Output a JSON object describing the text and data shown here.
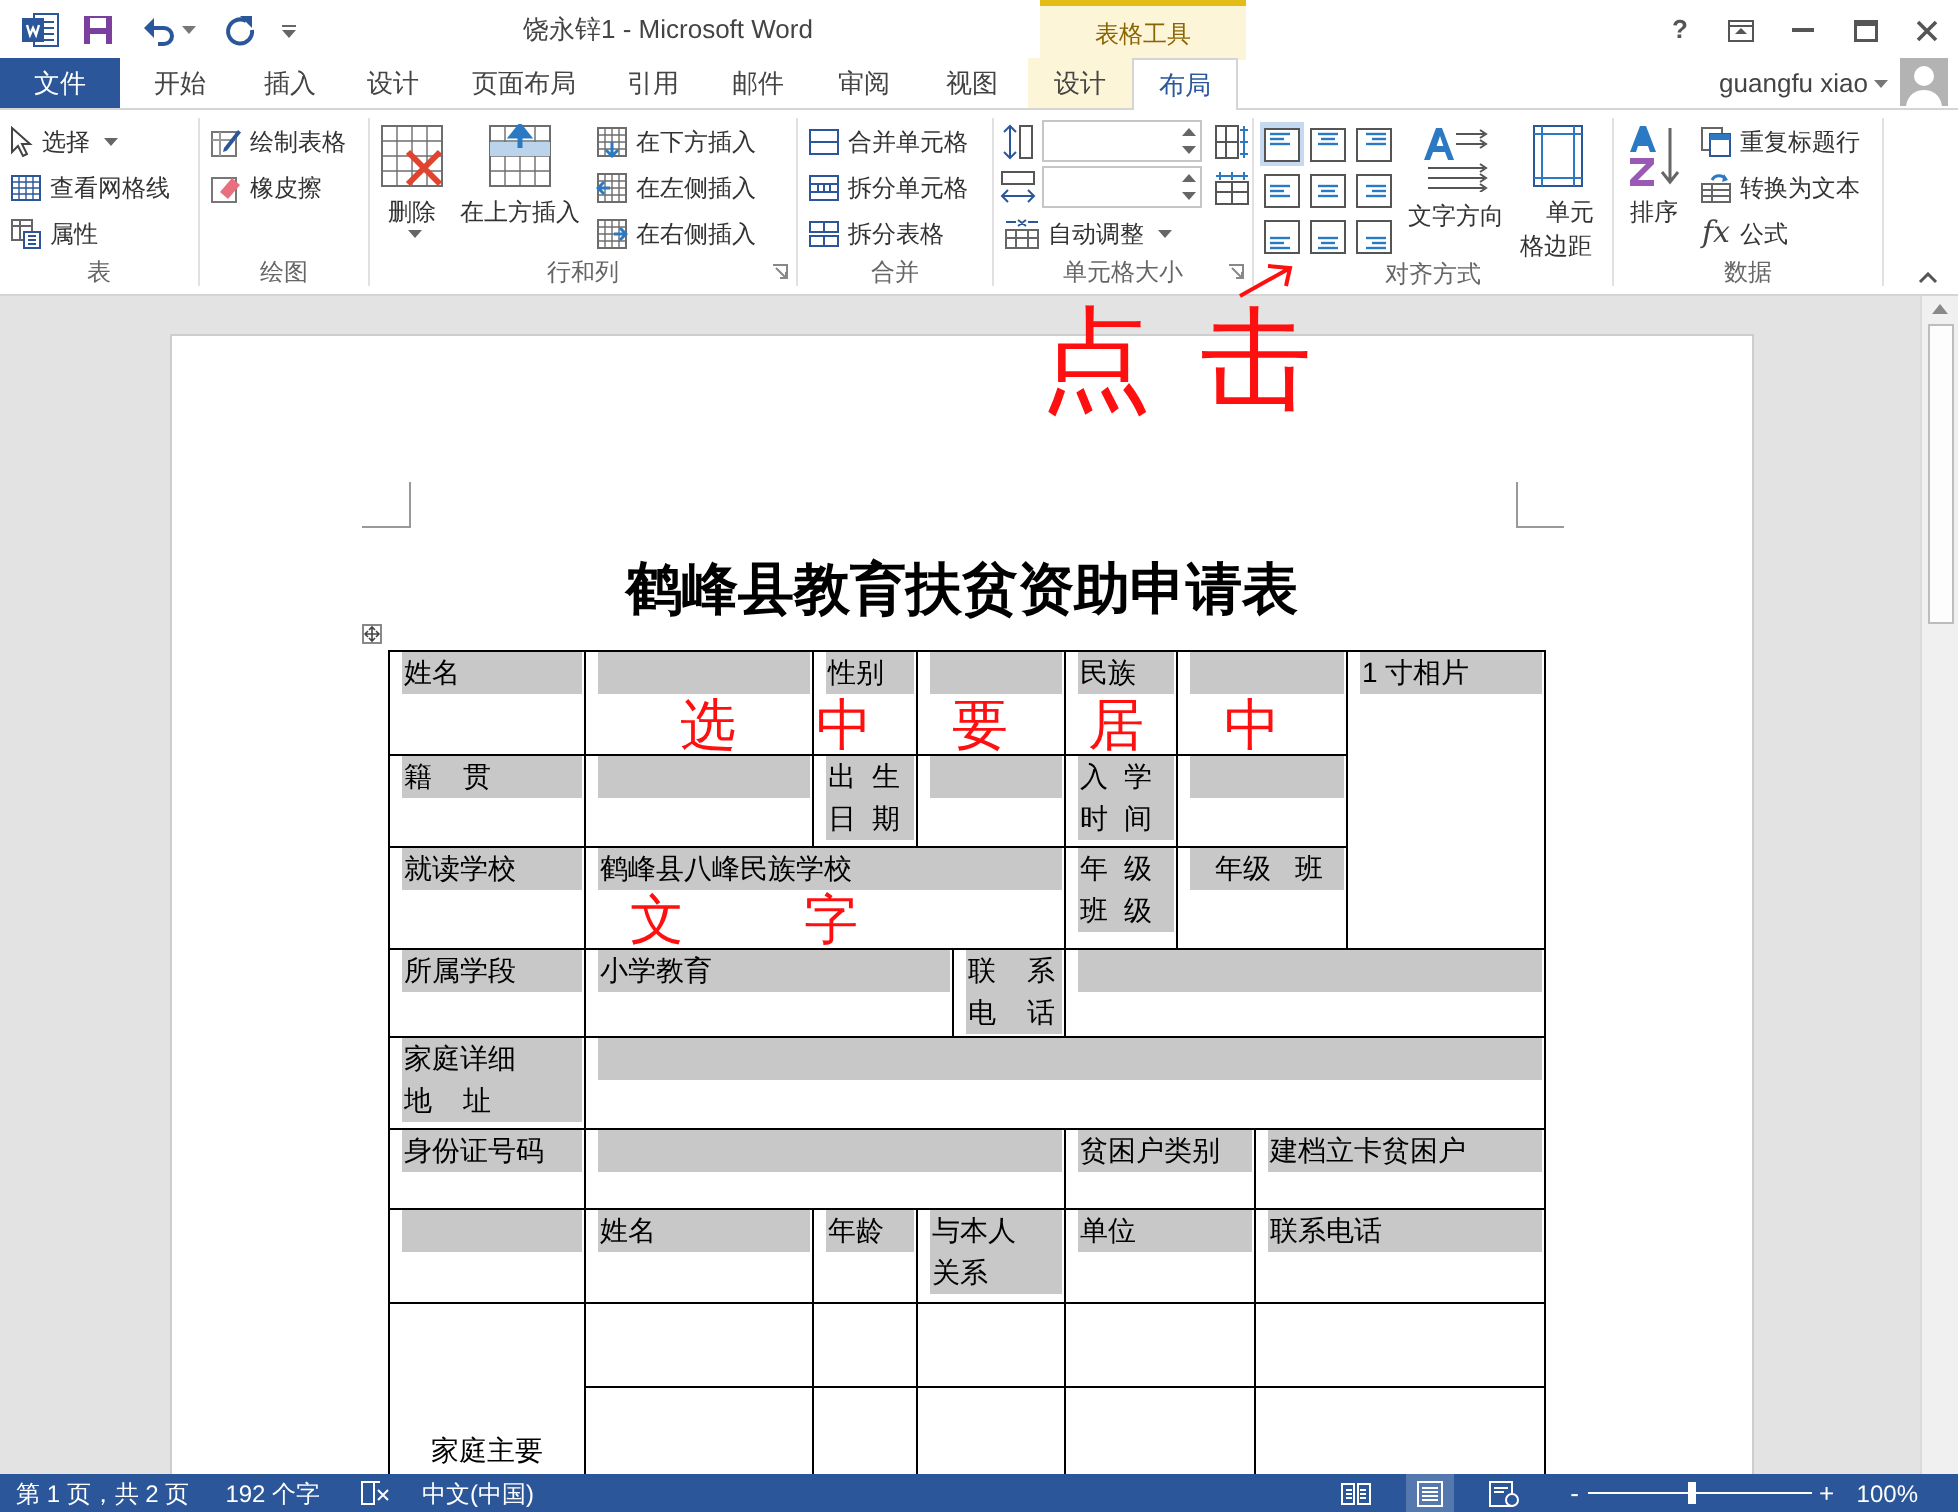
{
  "title_bar": {
    "title": "饶永锌1 - Microsoft Word",
    "contextual_group": "表格工具",
    "help": "?"
  },
  "tabs": [
    {
      "label": "文件",
      "kind": "file",
      "selected": false
    },
    {
      "label": "开始",
      "kind": "normal",
      "selected": false
    },
    {
      "label": "插入",
      "kind": "normal",
      "selected": false
    },
    {
      "label": "设计",
      "kind": "normal",
      "selected": false
    },
    {
      "label": "页面布局",
      "kind": "normal",
      "selected": false
    },
    {
      "label": "引用",
      "kind": "normal",
      "selected": false
    },
    {
      "label": "邮件",
      "kind": "normal",
      "selected": false
    },
    {
      "label": "审阅",
      "kind": "normal",
      "selected": false
    },
    {
      "label": "视图",
      "kind": "normal",
      "selected": false
    },
    {
      "label": "设计",
      "kind": "contextual",
      "selected": false
    },
    {
      "label": "布局",
      "kind": "contextual",
      "selected": true
    }
  ],
  "user": {
    "name": "guangfu xiao"
  },
  "ribbon": {
    "groups": [
      {
        "label": "表",
        "items": [
          {
            "kind": "small",
            "label": "选择",
            "dropdown": true
          },
          {
            "kind": "small",
            "label": "查看网格线"
          },
          {
            "kind": "small",
            "label": "属性"
          }
        ]
      },
      {
        "label": "绘图",
        "items": [
          {
            "kind": "small",
            "label": "绘制表格"
          },
          {
            "kind": "small",
            "label": "橡皮擦"
          }
        ]
      },
      {
        "label": "行和列",
        "launcher": true,
        "items": [
          {
            "kind": "large",
            "label": "删除",
            "dropdown": true
          },
          {
            "kind": "large",
            "label": "在上方插入"
          },
          {
            "kind": "small",
            "label": "在下方插入"
          },
          {
            "kind": "small",
            "label": "在左侧插入"
          },
          {
            "kind": "small",
            "label": "在右侧插入"
          }
        ]
      },
      {
        "label": "合并",
        "items": [
          {
            "kind": "small",
            "label": "合并单元格"
          },
          {
            "kind": "small",
            "label": "拆分单元格"
          },
          {
            "kind": "small",
            "label": "拆分表格"
          }
        ]
      },
      {
        "label": "单元格大小",
        "launcher": true,
        "items": [
          {
            "kind": "spinner"
          },
          {
            "kind": "spinner"
          },
          {
            "kind": "small",
            "label": "自动调整",
            "dropdown": true
          },
          {
            "kind": "icon"
          },
          {
            "kind": "icon"
          }
        ]
      },
      {
        "label": "对齐方式",
        "items": [
          {
            "kind": "align_grid",
            "cells": [
              {
                "selected": true
              },
              {
                "selected": false
              },
              {
                "selected": false
              },
              {
                "selected": false
              },
              {
                "selected": false
              },
              {
                "selected": false
              },
              {
                "selected": false
              },
              {
                "selected": false
              },
              {
                "selected": false
              }
            ]
          },
          {
            "kind": "large",
            "label": "文字方向"
          },
          {
            "kind": "large",
            "label": "单元格边距"
          }
        ]
      },
      {
        "label": "数据",
        "items": [
          {
            "kind": "large",
            "label": "排序"
          },
          {
            "kind": "small",
            "label": "重复标题行"
          },
          {
            "kind": "small",
            "label": "转换为文本"
          },
          {
            "kind": "small",
            "label": "公式",
            "glyph": "fx"
          }
        ]
      }
    ]
  },
  "document": {
    "heading": "鹤峰县教育扶贫资助申请表",
    "table": {
      "rows": [
        [
          {
            "text": "姓名",
            "selected": true
          },
          {
            "selected": true
          },
          {
            "text": "性别",
            "selected": true
          },
          {
            "selected": true
          },
          {
            "text": "民族",
            "selected": true
          },
          {
            "selected": true
          },
          {
            "text": "1 寸相片",
            "selected": true
          }
        ],
        [
          {
            "text": "籍    贯",
            "selected": true
          },
          {
            "selected": true
          },
          {
            "text": "出  生日  期",
            "selected": true
          },
          {
            "selected": true
          },
          {
            "text": "入  学时  间",
            "selected": true
          },
          {
            "selected": true
          }
        ],
        [
          {
            "text": "就读学校",
            "selected": true
          },
          {
            "text": "鹤峰县八峰民族学校",
            "selected": true
          },
          {
            "text": "年  级班  级",
            "selected": true
          },
          {
            "text": "   年级   班",
            "selected": true
          }
        ],
        [
          {
            "text": "所属学段",
            "selected": true
          },
          {
            "text": "小学教育",
            "selected": true
          },
          {
            "text": "联    系电    话",
            "selected": true
          },
          {
            "selected": true
          }
        ],
        [
          {
            "text": "家庭详细地    址",
            "selected": true
          },
          {
            "selected": true
          }
        ],
        [
          {
            "text": "身份证号码",
            "selected": true
          },
          {
            "selected": true
          },
          {
            "text": "贫困户类别",
            "selected": true
          },
          {
            "text": "建档立卡贫困户",
            "selected": true
          }
        ],
        [
          {
            "selected": true
          },
          {
            "text": "姓名",
            "selected": true
          },
          {
            "text": "年龄",
            "selected": true
          },
          {
            "text": "与本人关系",
            "selected": true
          },
          {
            "text": "单位",
            "selected": true
          },
          {
            "text": "联系电话",
            "selected": true
          }
        ],
        [
          {
            "text": "家庭主要",
            "selected": false
          },
          {
            "selected": false
          },
          {
            "selected": false
          },
          {
            "selected": false
          },
          {
            "selected": false
          },
          {
            "selected": false
          }
        ],
        [
          {
            "selected": false
          },
          {
            "selected": false
          },
          {
            "selected": false
          },
          {
            "selected": false
          },
          {
            "selected": false
          }
        ]
      ]
    }
  },
  "annotations": [
    {
      "text": "点击"
    },
    {
      "text": "选中要居中"
    },
    {
      "text": "文字"
    }
  ],
  "status_bar": {
    "page": "第 1 页，共 2 页",
    "words": "192 个字",
    "language": "中文(中国)",
    "views": [
      {
        "selected": false
      },
      {
        "selected": true
      },
      {
        "selected": false
      }
    ],
    "zoom": {
      "minus": "-",
      "level": 0.46,
      "plus": "+",
      "reading": "100%"
    }
  }
}
